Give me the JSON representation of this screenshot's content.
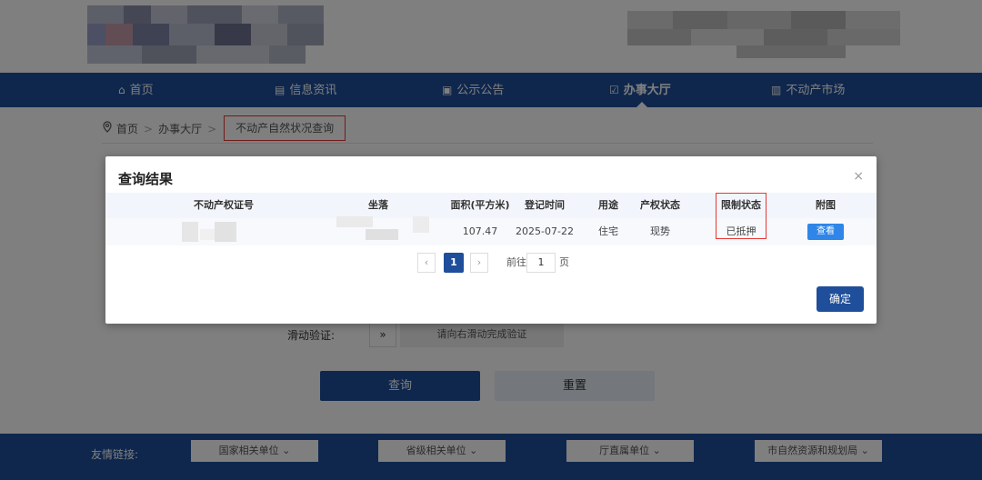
{
  "nav": {
    "items": [
      {
        "label": "首页",
        "icon": "home-icon",
        "glyph": "⌂"
      },
      {
        "label": "信息资讯",
        "icon": "document-icon",
        "glyph": "▤"
      },
      {
        "label": "公示公告",
        "icon": "briefcase-icon",
        "glyph": "▣"
      },
      {
        "label": "办事大厅",
        "icon": "checkbox-icon",
        "glyph": "☑"
      },
      {
        "label": "不动产市场",
        "icon": "building-icon",
        "glyph": "▥"
      }
    ],
    "active_index": 3
  },
  "breadcrumb": {
    "home": "首页",
    "hall": "办事大厅",
    "current": "不动产自然状况查询",
    "separator": ">"
  },
  "form": {
    "slide_label": "滑动验证:",
    "slide_glyph": "»",
    "slide_hint": "请向右滑动完成验证",
    "query_button": "查询",
    "reset_button": "重置"
  },
  "modal": {
    "title": "查询结果",
    "close_glyph": "×",
    "columns": [
      "不动产权证号",
      "坐落",
      "面积(平方米)",
      "登记时间",
      "用途",
      "产权状态",
      "限制状态",
      "附图"
    ],
    "row": {
      "area": "107.47",
      "date": "2025-07-22",
      "usage": "住宅",
      "property_status": "现势",
      "restriction_status": "已抵押",
      "view_button": "查看"
    },
    "pagination": {
      "prev": "‹",
      "current_page": "1",
      "next": "›",
      "goto_label": "前往",
      "goto_value": "1",
      "page_suffix": "页"
    },
    "confirm_button": "确定"
  },
  "footer": {
    "label": "友情链接:",
    "links": [
      "国家相关单位 ⌄",
      "省级相关单位 ⌄",
      "厅直属单位 ⌄",
      "市自然资源和规划局 ⌄"
    ]
  },
  "colors": {
    "nav_blue": "#1f4e9a",
    "highlight_red": "#e53935",
    "view_button_blue": "#2f86e8"
  }
}
